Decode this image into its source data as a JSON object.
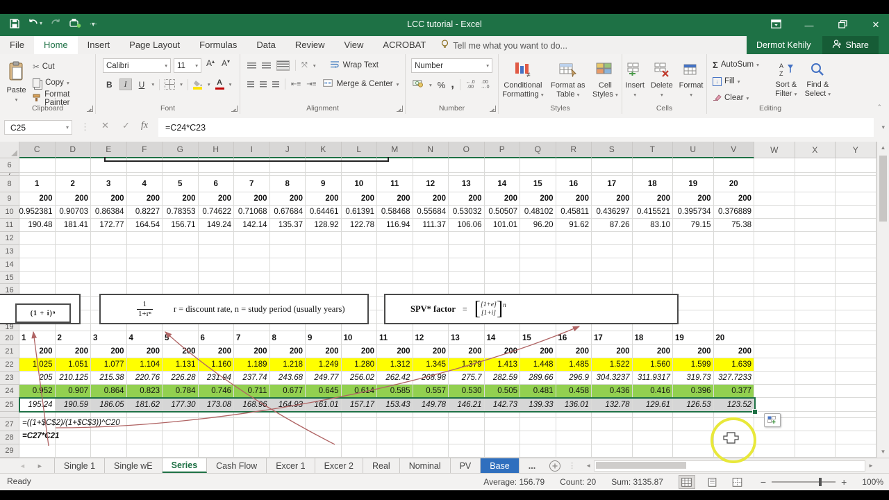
{
  "titlebar": {
    "title": "LCC tutorial - Excel",
    "user": "Dermot Kehily",
    "share_label": "Share"
  },
  "ribbon_tabs": [
    {
      "label": "File"
    },
    {
      "label": "Home"
    },
    {
      "label": "Insert"
    },
    {
      "label": "Page Layout"
    },
    {
      "label": "Formulas"
    },
    {
      "label": "Data"
    },
    {
      "label": "Review"
    },
    {
      "label": "View"
    },
    {
      "label": "ACROBAT"
    }
  ],
  "tell_me": "Tell me what you want to do...",
  "ribbon": {
    "clipboard": {
      "label": "Clipboard",
      "paste": "Paste",
      "cut": "Cut",
      "copy": "Copy",
      "format_painter": "Format Painter"
    },
    "font": {
      "label": "Font",
      "font_name": "Calibri",
      "font_size": "11",
      "bold": "B",
      "italic": "I",
      "underline": "U"
    },
    "alignment": {
      "label": "Alignment",
      "wrap_text": "Wrap Text",
      "merge_center": "Merge & Center"
    },
    "number": {
      "label": "Number",
      "format": "Number",
      "percent": "%",
      "comma": ","
    },
    "styles": {
      "label": "Styles",
      "conditional1": "Conditional",
      "conditional2": "Formatting",
      "table1": "Format as",
      "table2": "Table",
      "cellstyles1": "Cell",
      "cellstyles2": "Styles"
    },
    "cells": {
      "label": "Cells",
      "insert": "Insert",
      "delete": "Delete",
      "format": "Format"
    },
    "editing": {
      "label": "Editing",
      "autosum": "AutoSum",
      "fill": "Fill",
      "clear": "Clear",
      "sort1": "Sort &",
      "sort2": "Filter",
      "find1": "Find &",
      "find2": "Select"
    }
  },
  "formula_bar": {
    "name_box": "C25",
    "formula": "=C24*C23"
  },
  "grid": {
    "columns": [
      "C",
      "D",
      "E",
      "F",
      "G",
      "H",
      "I",
      "J",
      "K",
      "L",
      "M",
      "N",
      "O",
      "P",
      "Q",
      "R",
      "S",
      "T",
      "U",
      "V",
      "W",
      "X",
      "Y"
    ],
    "values": {
      "r8": [
        "1",
        "2",
        "3",
        "4",
        "5",
        "6",
        "7",
        "8",
        "9",
        "10",
        "11",
        "12",
        "13",
        "14",
        "15",
        "16",
        "17",
        "18",
        "19",
        "20"
      ],
      "r9": [
        "200",
        "200",
        "200",
        "200",
        "200",
        "200",
        "200",
        "200",
        "200",
        "200",
        "200",
        "200",
        "200",
        "200",
        "200",
        "200",
        "200",
        "200",
        "200",
        "200"
      ],
      "r10": [
        "0.952381",
        "0.90703",
        "0.86384",
        "0.8227",
        "0.78353",
        "0.74622",
        "0.71068",
        "0.67684",
        "0.64461",
        "0.61391",
        "0.58468",
        "0.55684",
        "0.53032",
        "0.50507",
        "0.48102",
        "0.45811",
        "0.436297",
        "0.415521",
        "0.395734",
        "0.376889"
      ],
      "r11": [
        "190.48",
        "181.41",
        "172.77",
        "164.54",
        "156.71",
        "149.24",
        "142.14",
        "135.37",
        "128.92",
        "122.78",
        "116.94",
        "111.37",
        "106.06",
        "101.01",
        "96.20",
        "91.62",
        "87.26",
        "83.10",
        "79.15",
        "75.38"
      ],
      "r20": [
        "1",
        "2",
        "3",
        "4",
        "5",
        "6",
        "7",
        "8",
        "9",
        "10",
        "11",
        "12",
        "13",
        "14",
        "15",
        "16",
        "17",
        "18",
        "19",
        "20"
      ],
      "r21": [
        "200",
        "200",
        "200",
        "200",
        "200",
        "200",
        "200",
        "200",
        "200",
        "200",
        "200",
        "200",
        "200",
        "200",
        "200",
        "200",
        "200",
        "200",
        "200",
        "200"
      ],
      "r22": [
        "1.025",
        "1.051",
        "1.077",
        "1.104",
        "1.131",
        "1.160",
        "1.189",
        "1.218",
        "1.249",
        "1.280",
        "1.312",
        "1.345",
        "1.379",
        "1.413",
        "1.448",
        "1.485",
        "1.522",
        "1.560",
        "1.599",
        "1.639"
      ],
      "r23": [
        "205",
        "210.125",
        "215.38",
        "220.76",
        "226.28",
        "231.94",
        "237.74",
        "243.68",
        "249.77",
        "256.02",
        "262.42",
        "268.98",
        "275.7",
        "282.59",
        "289.66",
        "296.9",
        "304.3237",
        "311.9317",
        "319.73",
        "327.7233"
      ],
      "r24": [
        "0.952",
        "0.907",
        "0.864",
        "0.823",
        "0.784",
        "0.746",
        "0.711",
        "0.677",
        "0.645",
        "0.614",
        "0.585",
        "0.557",
        "0.530",
        "0.505",
        "0.481",
        "0.458",
        "0.436",
        "0.416",
        "0.396",
        "0.377"
      ],
      "r25": [
        "195.24",
        "190.59",
        "186.05",
        "181.62",
        "177.30",
        "173.08",
        "168.96",
        "164.93",
        "161.01",
        "157.17",
        "153.43",
        "149.78",
        "146.21",
        "142.73",
        "139.33",
        "136.01",
        "132.78",
        "129.61",
        "126.53",
        "123.52"
      ],
      "f27": "=((1+$C$2)/(1+$C$3))^C20",
      "f28": "=C27*C21"
    }
  },
  "annotations": {
    "left_box": "(1 + i)ⁿ",
    "mid_num": "1",
    "mid_den": "1+rⁿ",
    "mid_text": "r = discount rate, n = study period (usually years)",
    "spv_label": "SPV* factor",
    "spv_eq": "=",
    "spv_num": "[1+e]",
    "spv_den": "[1+i]",
    "spv_exp": "n"
  },
  "sheet_tabs": [
    {
      "label": "Single 1",
      "style": ""
    },
    {
      "label": "Single  wE",
      "style": ""
    },
    {
      "label": "Series",
      "style": "active"
    },
    {
      "label": "Cash Flow",
      "style": ""
    },
    {
      "label": "Excer 1",
      "style": ""
    },
    {
      "label": "Excer 2",
      "style": ""
    },
    {
      "label": "Real",
      "style": ""
    },
    {
      "label": "Nominal",
      "style": ""
    },
    {
      "label": "PV",
      "style": ""
    },
    {
      "label": "Base",
      "style": "blue"
    },
    {
      "label": "...",
      "style": "more"
    }
  ],
  "status_bar": {
    "ready": "Ready",
    "average": "Average: 156.79",
    "count": "Count: 20",
    "sum": "Sum: 3135.87",
    "zoom": "100%"
  }
}
